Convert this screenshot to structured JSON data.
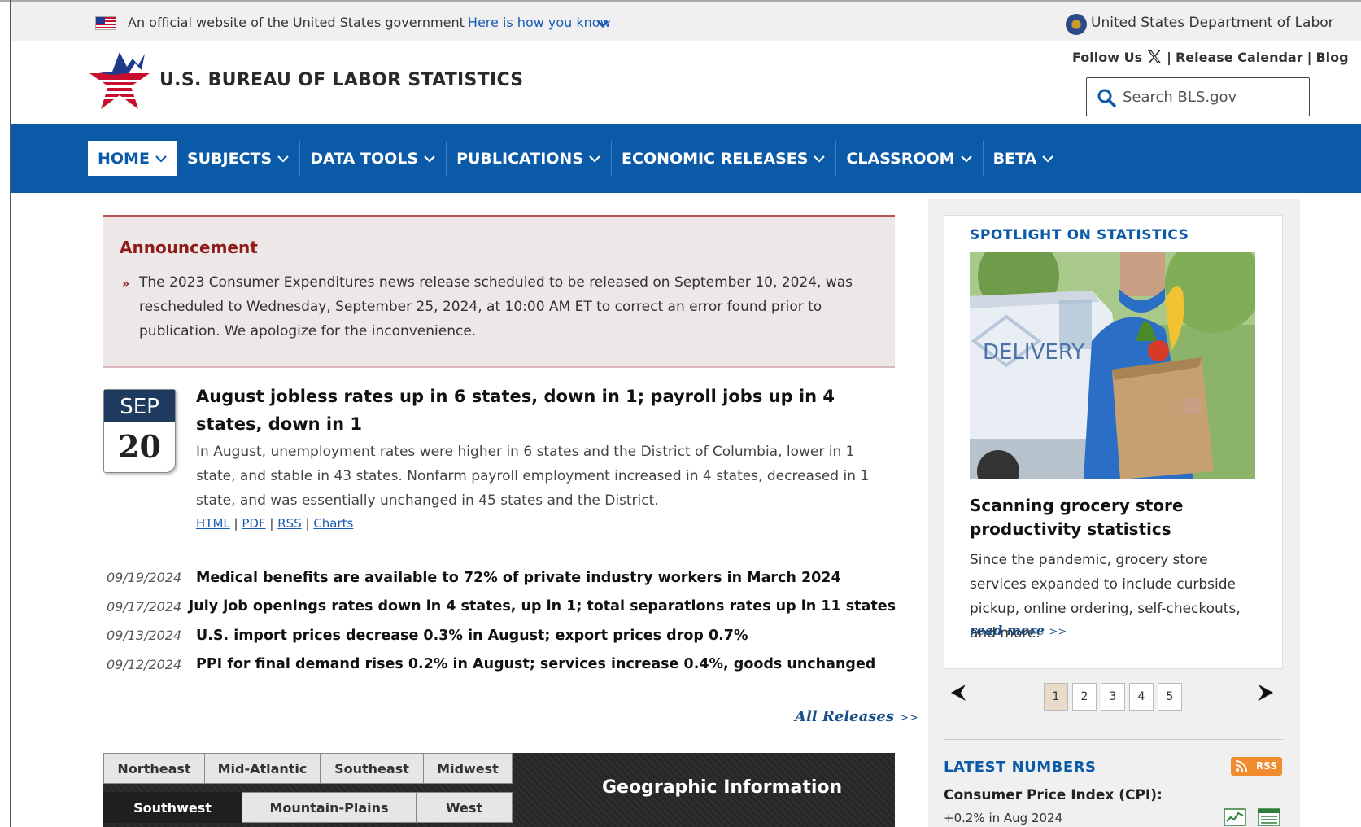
{
  "artifact_text": "",
  "gov_banner": {
    "text": "An official website of the United States government",
    "link": "Here is how you know",
    "agency": "United States Department of Labor"
  },
  "header": {
    "site_title": "U.S. BUREAU OF LABOR STATISTICS",
    "follow_us": "Follow Us",
    "release_calendar": "Release Calendar",
    "blog": "Blog",
    "separator": "|",
    "search_placeholder": "Search BLS.gov"
  },
  "nav": {
    "items": [
      {
        "label": "HOME"
      },
      {
        "label": "SUBJECTS"
      },
      {
        "label": "DATA TOOLS"
      },
      {
        "label": "PUBLICATIONS"
      },
      {
        "label": "ECONOMIC RELEASES"
      },
      {
        "label": "CLASSROOM"
      },
      {
        "label": "BETA"
      }
    ]
  },
  "announcement": {
    "title": "Announcement",
    "bullet": "»",
    "text": "The 2023 Consumer Expenditures news release scheduled to be released on September 10, 2024, was rescheduled to Wednesday, September 25, 2024, at 10:00 AM ET to correct an error found prior to publication. We apologize for the inconvenience."
  },
  "featured": {
    "month": "SEP",
    "day": "20",
    "title": "August jobless rates up in 6 states, down in 1; payroll jobs up in 4 states, down in 1",
    "description": "In August, unemployment rates were higher in 6 states and the District of Columbia, lower in 1 state, and stable in 43 states. Nonfarm payroll employment increased in 4 states, decreased in 1 state, and was essentially unchanged in 45 states and the District.",
    "links": [
      "HTML",
      "PDF",
      "RSS",
      "Charts"
    ],
    "link_sep": "|"
  },
  "releases": [
    {
      "date": "09/19/2024",
      "title": "Medical benefits are available to 72% of private industry workers in March 2024"
    },
    {
      "date": "09/17/2024",
      "title": "July job openings rates down in 4 states, up in 1; total separations rates up in 11 states"
    },
    {
      "date": "09/13/2024",
      "title": "U.S. import prices decrease 0.3% in August; export prices drop 0.7%"
    },
    {
      "date": "09/12/2024",
      "title": "PPI for final demand rises 0.2% in August; services increase 0.4%, goods unchanged"
    }
  ],
  "all_releases": "All Releases",
  "all_releases_arrow": ">>",
  "geo": {
    "title": "Geographic Information",
    "tabs": [
      "Northeast",
      "Mid-Atlantic",
      "Southeast",
      "Midwest",
      "Southwest",
      "Mountain-Plains",
      "West"
    ],
    "active_tab": "Southwest"
  },
  "spotlight": {
    "heading": "SPOTLIGHT ON STATISTICS",
    "image_text": "DELIVERY",
    "title": "Scanning grocery store productivity statistics",
    "description": "Since the pandemic, grocery store services expanded to include curbside pickup, online ordering, self-checkouts, and more.",
    "read_more": "read more",
    "read_more_arrow": ">>",
    "pages": [
      "1",
      "2",
      "3",
      "4",
      "5"
    ],
    "active_page": "1"
  },
  "latest": {
    "heading": "LATEST NUMBERS",
    "rss": "RSS",
    "cpi_label": "Consumer Price Index (CPI):",
    "cpi_value": "+0.2% in Aug 2024"
  },
  "colors": {
    "nav_blue": "#0a5aa8",
    "announce_red": "#8f1a1a",
    "date_badge": "#1e3a5f",
    "link_blue": "#1a5bb5",
    "rss_orange": "#f08b2e"
  },
  "icons": [
    "us-flag-icon",
    "chevron-down-icon",
    "dol-seal-icon",
    "bls-star-logo",
    "x-logo-icon",
    "search-icon",
    "caret-left-icon",
    "caret-right-icon",
    "rss-icon",
    "chart-icon",
    "table-icon"
  ]
}
